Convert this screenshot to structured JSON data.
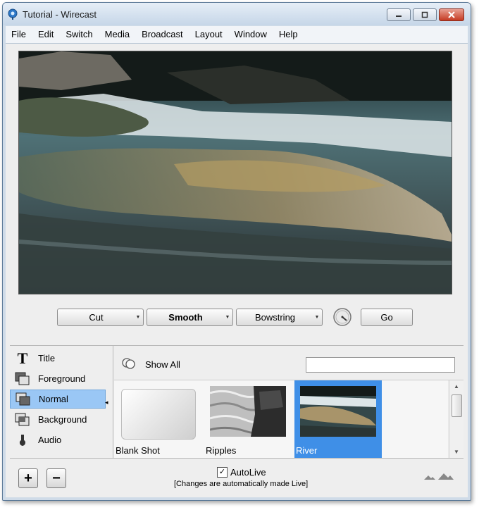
{
  "window": {
    "title": "Tutorial - Wirecast"
  },
  "menu": [
    "File",
    "Edit",
    "Switch",
    "Media",
    "Broadcast",
    "Layout",
    "Window",
    "Help"
  ],
  "transitions": {
    "cut_label": "Cut",
    "smooth_label": "Smooth",
    "bowstring_label": "Bowstring",
    "go_label": "Go"
  },
  "layers": [
    {
      "label": "Title",
      "icon": "title-layer-icon"
    },
    {
      "label": "Foreground",
      "icon": "foreground-layer-icon"
    },
    {
      "label": "Normal",
      "icon": "normal-layer-icon",
      "selected": true
    },
    {
      "label": "Background",
      "icon": "background-layer-icon"
    },
    {
      "label": "Audio",
      "icon": "audio-layer-icon"
    }
  ],
  "shots_toolbar": {
    "show_all_label": "Show All",
    "search_value": ""
  },
  "shots": [
    {
      "label": "Blank Shot"
    },
    {
      "label": "Ripples"
    },
    {
      "label": "River",
      "selected": true
    }
  ],
  "bottom": {
    "add_label": "+",
    "remove_label": "−",
    "autolive_label": "AutoLive",
    "autolive_checked": true,
    "autolive_note": "[Changes are automatically made Live]"
  },
  "colors": {
    "selection": "#3f8fe7",
    "layer_selection": "#9ac7f5"
  }
}
